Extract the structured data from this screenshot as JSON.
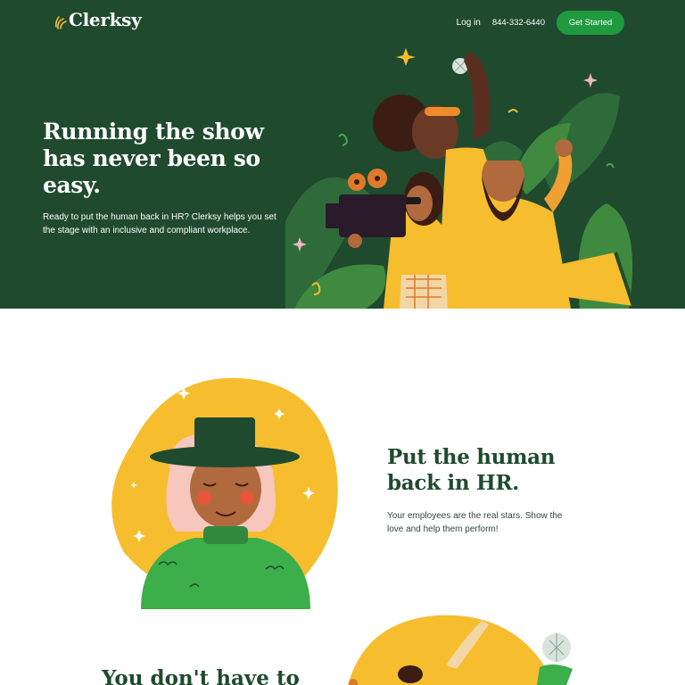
{
  "brand": {
    "name": "Clerksy"
  },
  "nav": {
    "login_label": "Log in",
    "phone": "844-332-6440",
    "cta_label": "Get Started"
  },
  "hero": {
    "title": "Running the show has never been so easy.",
    "subtitle": "Ready to put the human back in HR? Clerksy helps you set the stage with an inclusive and compliant workplace."
  },
  "section_human": {
    "title": "Put the human back in HR.",
    "subtitle": "Your employees are the real stars. Show the love and help them perform!"
  },
  "section_next": {
    "title": "You don't have to"
  },
  "colors": {
    "hero_bg": "#1f4a2e",
    "accent_green": "#1f9a3f",
    "accent_yellow": "#f6bd2e",
    "heading_green": "#1f4a2e"
  },
  "icons": {
    "logo": "clerksy-spark-icon",
    "hero_illustration": "film-crew-illustration",
    "portrait_illustration": "woman-in-hat-illustration",
    "section3_illustration": "sports-illustration"
  }
}
